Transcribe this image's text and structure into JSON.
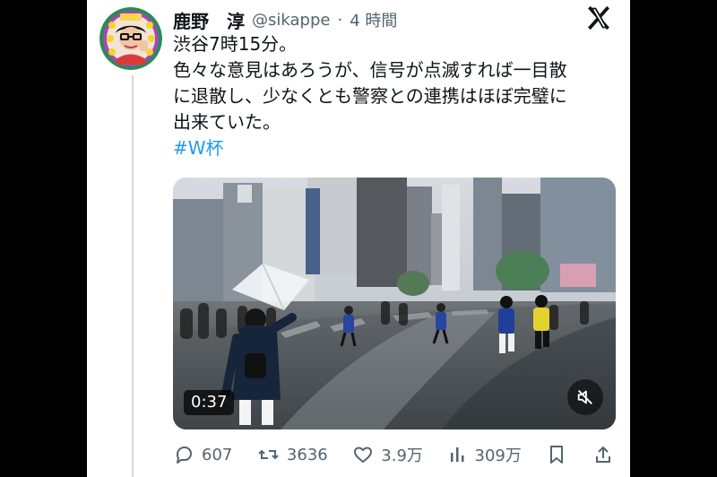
{
  "post": {
    "author": {
      "display_name": "鹿野　淳",
      "handle": "@sikappe",
      "separator": "·",
      "time": "4 時間"
    },
    "text_lines": [
      "渋谷7時15分。",
      "色々な意見はあろうが、信号が点滅すれば一目散",
      "に退散し、少なくとも警察との連携はほぼ完璧に",
      "出来ていた。"
    ],
    "hashtag": "#W杯",
    "media": {
      "duration": "0:37",
      "mute_icon": "mute-icon"
    },
    "actions": {
      "replies": "607",
      "reposts": "3636",
      "likes": "3.9万",
      "views": "309万"
    }
  },
  "brand": {
    "logo_icon": "x-logo",
    "color_text": "#0f1419",
    "color_secondary": "#536471",
    "color_accent": "#1d9bf0"
  }
}
